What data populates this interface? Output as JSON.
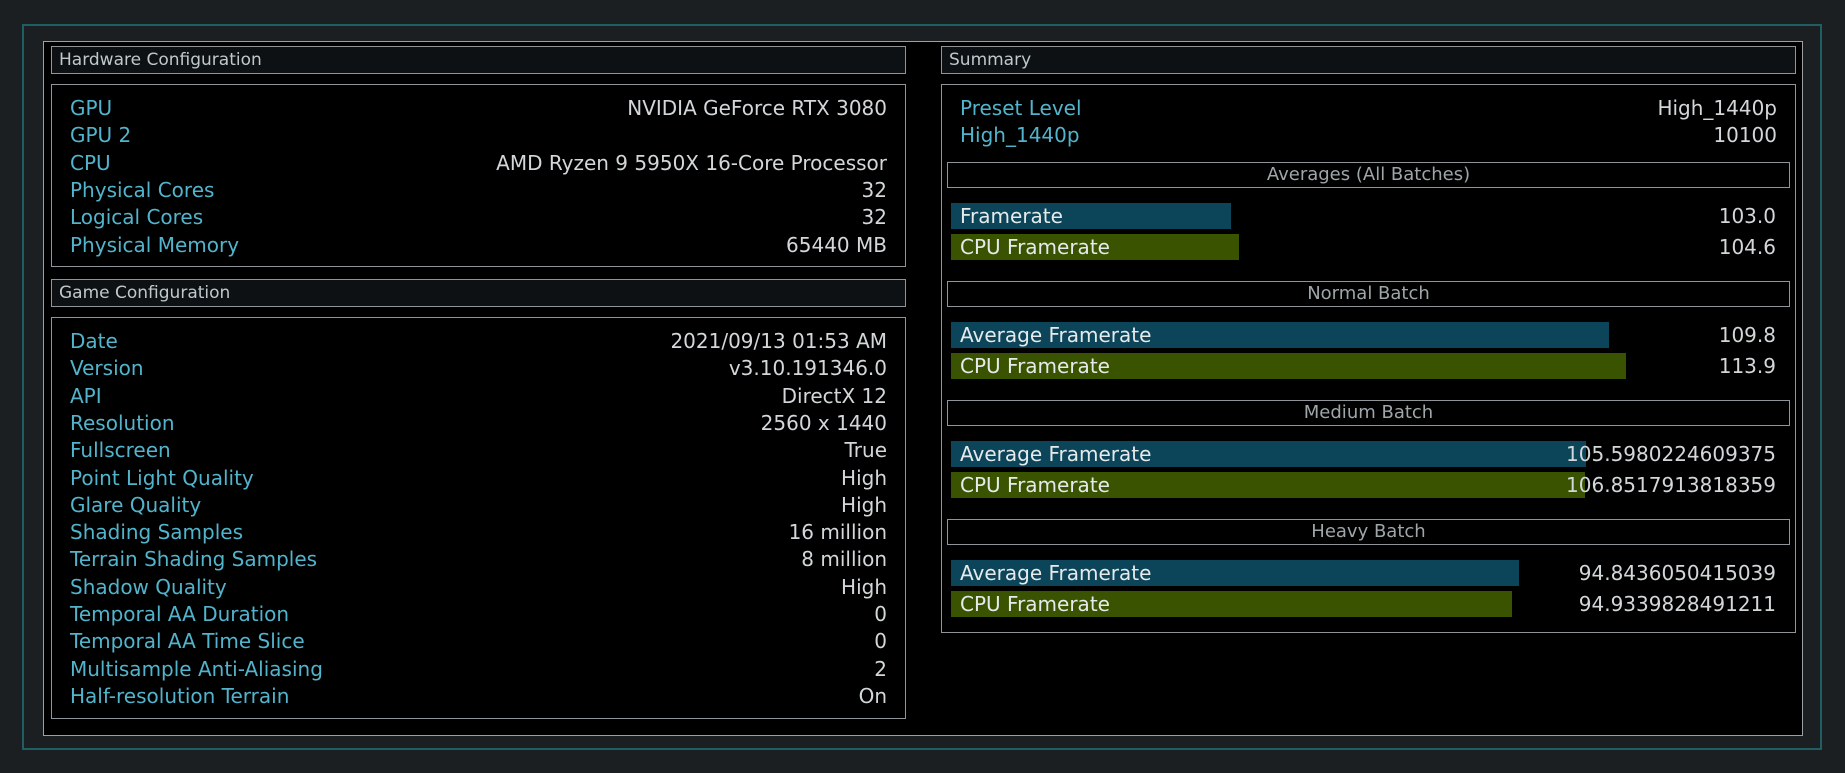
{
  "hardware": {
    "title": "Hardware Configuration",
    "rows": [
      {
        "label": "GPU",
        "value": "NVIDIA GeForce RTX 3080"
      },
      {
        "label": "GPU 2",
        "value": ""
      },
      {
        "label": "CPU",
        "value": "AMD Ryzen 9 5950X 16-Core Processor"
      },
      {
        "label": "Physical Cores",
        "value": "32"
      },
      {
        "label": "Logical Cores",
        "value": "32"
      },
      {
        "label": "Physical Memory",
        "value": "65440 MB"
      }
    ]
  },
  "game": {
    "title": "Game Configuration",
    "rows": [
      {
        "label": "Date",
        "value": "2021/09/13 01:53 AM"
      },
      {
        "label": "Version",
        "value": "v3.10.191346.0"
      },
      {
        "label": "API",
        "value": "DirectX 12"
      },
      {
        "label": "Resolution",
        "value": "2560 x 1440"
      },
      {
        "label": "Fullscreen",
        "value": "True"
      },
      {
        "label": "Point Light Quality",
        "value": "High"
      },
      {
        "label": "Glare Quality",
        "value": "High"
      },
      {
        "label": "Shading Samples",
        "value": "16 million"
      },
      {
        "label": "Terrain Shading Samples",
        "value": "8 million"
      },
      {
        "label": "Shadow Quality",
        "value": "High"
      },
      {
        "label": "Temporal AA Duration",
        "value": "0"
      },
      {
        "label": "Temporal AA Time Slice",
        "value": "0"
      },
      {
        "label": "Multisample Anti-Aliasing",
        "value": "2"
      },
      {
        "label": "Half-resolution Terrain",
        "value": "On"
      }
    ]
  },
  "summary": {
    "title": "Summary",
    "preset_label": "Preset Level",
    "preset_value": "High_1440p",
    "score_label": "High_1440p",
    "score_value": "10100",
    "sections": [
      {
        "title": "Averages (All Batches)",
        "bars": [
          {
            "label": "Framerate",
            "value": "103.0",
            "kind": "framerate",
            "fill_fraction": 0.339
          },
          {
            "label": "CPU Framerate",
            "value": "104.6",
            "kind": "cpu",
            "fill_fraction": 0.349
          }
        ]
      },
      {
        "title": "Normal Batch",
        "bars": [
          {
            "label": "Average Framerate",
            "value": "109.8",
            "kind": "framerate",
            "fill_fraction": 0.797
          },
          {
            "label": "CPU Framerate",
            "value": "113.9",
            "kind": "cpu",
            "fill_fraction": 0.817
          }
        ]
      },
      {
        "title": "Medium Batch",
        "bars": [
          {
            "label": "Average Framerate",
            "value": "105.5980224609375",
            "kind": "framerate",
            "fill_fraction": 0.769
          },
          {
            "label": "CPU Framerate",
            "value": "106.8517913818359",
            "kind": "cpu",
            "fill_fraction": 0.768
          }
        ]
      },
      {
        "title": "Heavy Batch",
        "bars": [
          {
            "label": "Average Framerate",
            "value": "94.8436050415039",
            "kind": "framerate",
            "fill_fraction": 0.688
          },
          {
            "label": "CPU Framerate",
            "value": "94.9339828491211",
            "kind": "cpu",
            "fill_fraction": 0.679
          }
        ]
      }
    ]
  },
  "colors": {
    "label_blue": "#52b4cc",
    "framerate_bar": "#0c4559",
    "cpu_bar": "#3a5301",
    "frame_border": "#1f5e63"
  }
}
